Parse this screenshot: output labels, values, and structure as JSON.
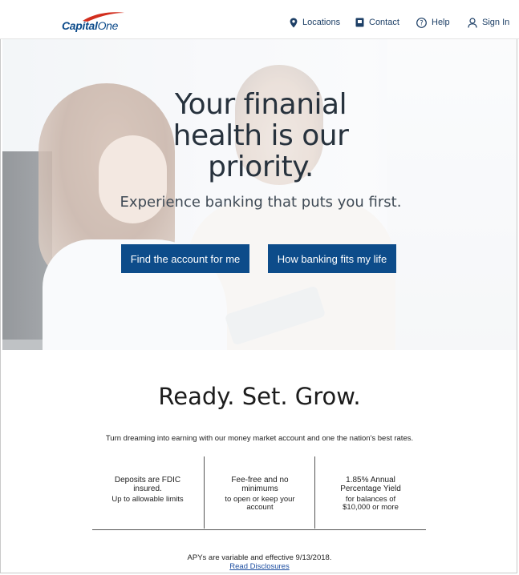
{
  "header": {
    "logo_brand": "Capital",
    "logo_brand_2": "One",
    "nav": [
      {
        "label": "Locations",
        "icon": "location-pin-icon"
      },
      {
        "label": "Contact",
        "icon": "contact-book-icon"
      },
      {
        "label": "Help",
        "icon": "help-circle-icon"
      },
      {
        "label": "Sign In",
        "icon": "user-icon"
      }
    ]
  },
  "hero": {
    "title": "Your finanial health is our priority.",
    "subtitle": "Experience banking that puts you first.",
    "buttons": {
      "find": "Find the account for me",
      "how": "How banking fits my life"
    }
  },
  "ready": {
    "title": "Ready. Set. Grow.",
    "text": "Turn dreaming into earning with our money market account and one the nation's best rates.",
    "features": [
      {
        "head": "Deposits are FDIC insured.",
        "sub": "Up to allowable limits"
      },
      {
        "head": "Fee-free and no minimums",
        "sub": "to open or keep your account"
      },
      {
        "head": "1.85% Annual Percentage Yield",
        "sub": "for balances of $10,000 or more"
      }
    ],
    "apy_note": "APYs are variable and effective 9/13/2018.",
    "disclosures_link": "Read Disclosures"
  },
  "colors": {
    "brand_blue": "#0d4c8a",
    "logo_red": "#d22e1e",
    "nav_text": "#1d3f66"
  }
}
